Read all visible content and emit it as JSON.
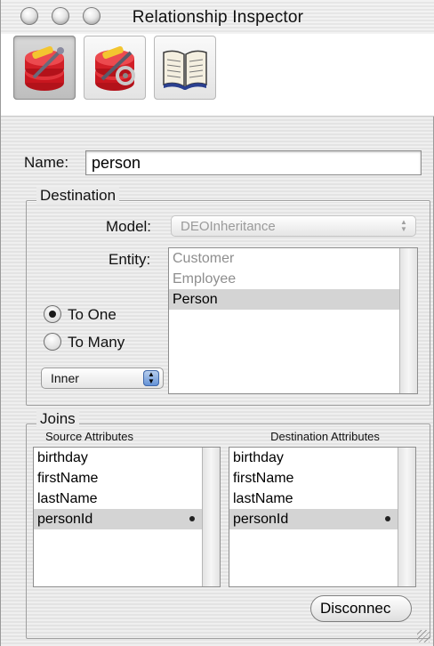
{
  "window": {
    "title": "Relationship Inspector"
  },
  "toolbar": {
    "tools": [
      {
        "icon": "relationship-inspector-icon",
        "selected": true
      },
      {
        "icon": "advanced-relationship-icon",
        "selected": false
      },
      {
        "icon": "book-icon",
        "selected": false
      }
    ]
  },
  "name": {
    "label": "Name:",
    "value": "person"
  },
  "destination": {
    "title": "Destination",
    "model_label": "Model:",
    "model_value": "DEOInheritance",
    "entity_label": "Entity:",
    "entities": [
      {
        "label": "Customer",
        "selected": false
      },
      {
        "label": "Employee",
        "selected": false
      },
      {
        "label": "Person",
        "selected": true
      }
    ],
    "to_one_label": "To One",
    "to_many_label": "To Many",
    "cardinality": "To One",
    "join_type": "Inner"
  },
  "joins": {
    "title": "Joins",
    "source_header": "Source Attributes",
    "dest_header": "Destination Attributes",
    "source_attributes": [
      "birthday",
      "firstName",
      "lastName",
      "personId"
    ],
    "destination_attributes": [
      "birthday",
      "firstName",
      "lastName",
      "personId"
    ],
    "selected": "personId",
    "disconnect_label": "Disconnec"
  }
}
